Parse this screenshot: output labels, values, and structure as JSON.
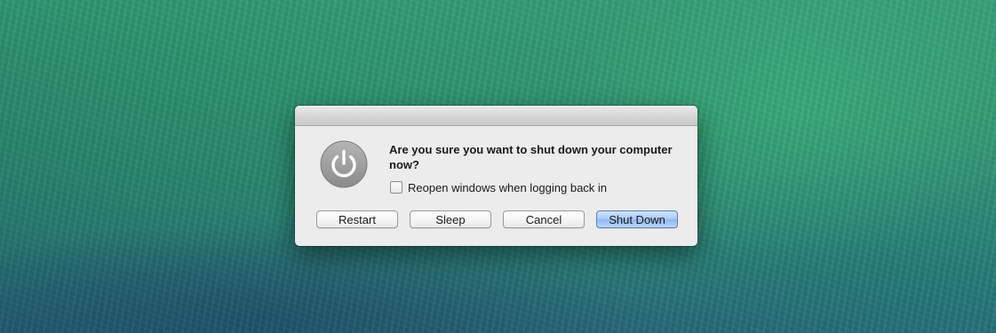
{
  "dialog": {
    "message": "Are you sure you want to shut down your computer now?",
    "checkbox_label": "Reopen windows when logging back in",
    "checkbox_checked": false,
    "icon": "power-icon"
  },
  "buttons": {
    "restart": "Restart",
    "sleep": "Sleep",
    "cancel": "Cancel",
    "shut_down": "Shut Down"
  },
  "colors": {
    "default_button": "#a7c9f5",
    "wallpaper": "#2f8f6d"
  }
}
